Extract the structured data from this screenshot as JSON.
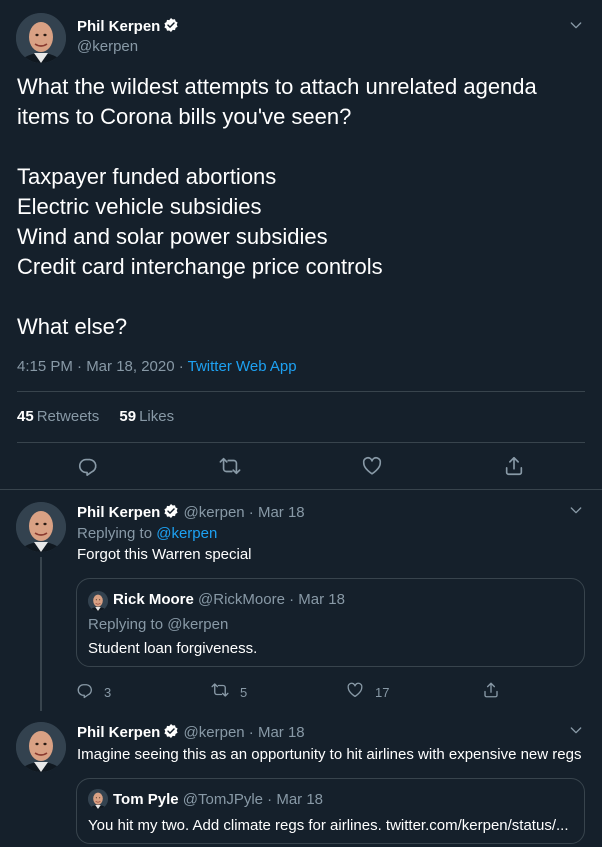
{
  "main_tweet": {
    "author_name": "Phil Kerpen",
    "author_handle": "@kerpen",
    "body_lines": [
      "What the wildest attempts to attach unrelated agenda",
      "items to Corona bills you've seen?",
      "Taxpayer funded abortions",
      "Electric vehicle subsidies",
      "Wind and solar power subsidies",
      "Credit card interchange price controls",
      "What else?"
    ],
    "timestamp": "4:15 PM · Mar 18, 2020 · ",
    "source": "Twitter Web App",
    "retweet_count": "45",
    "retweet_label": "Retweets",
    "like_count": "59",
    "like_label": "Likes",
    "icons": [
      "reply-icon",
      "retweet-icon",
      "like-icon",
      "share-icon"
    ]
  },
  "replies": [
    {
      "author_name": "Phil Kerpen",
      "author_handle": "@kerpen",
      "date": "· Mar 18",
      "replying_prefix": "Replying to ",
      "replying_to": "@kerpen",
      "text": "Forgot this Warren special",
      "quote": {
        "author_name": "Rick Moore",
        "author_handle": "@RickMoore",
        "date": "· Mar 18",
        "replying_line": "Replying to @kerpen",
        "text": "Student loan forgiveness."
      },
      "reply_count": "3",
      "retweet_count": "5",
      "like_count": "17"
    },
    {
      "author_name": "Phil Kerpen",
      "author_handle": "@kerpen",
      "date": "· Mar 18",
      "text": "Imagine seeing this as an opportunity to hit airlines with expensive new regs",
      "quote": {
        "author_name": "Tom Pyle",
        "author_handle": "@TomJPyle",
        "date": "· Mar 18",
        "text": "You hit my two. Add climate regs for airlines. twitter.com/kerpen/status/..."
      }
    }
  ],
  "colors": {
    "background": "#15202b",
    "border": "#38444d",
    "muted_text": "#8899a6",
    "link": "#1da1f2"
  }
}
